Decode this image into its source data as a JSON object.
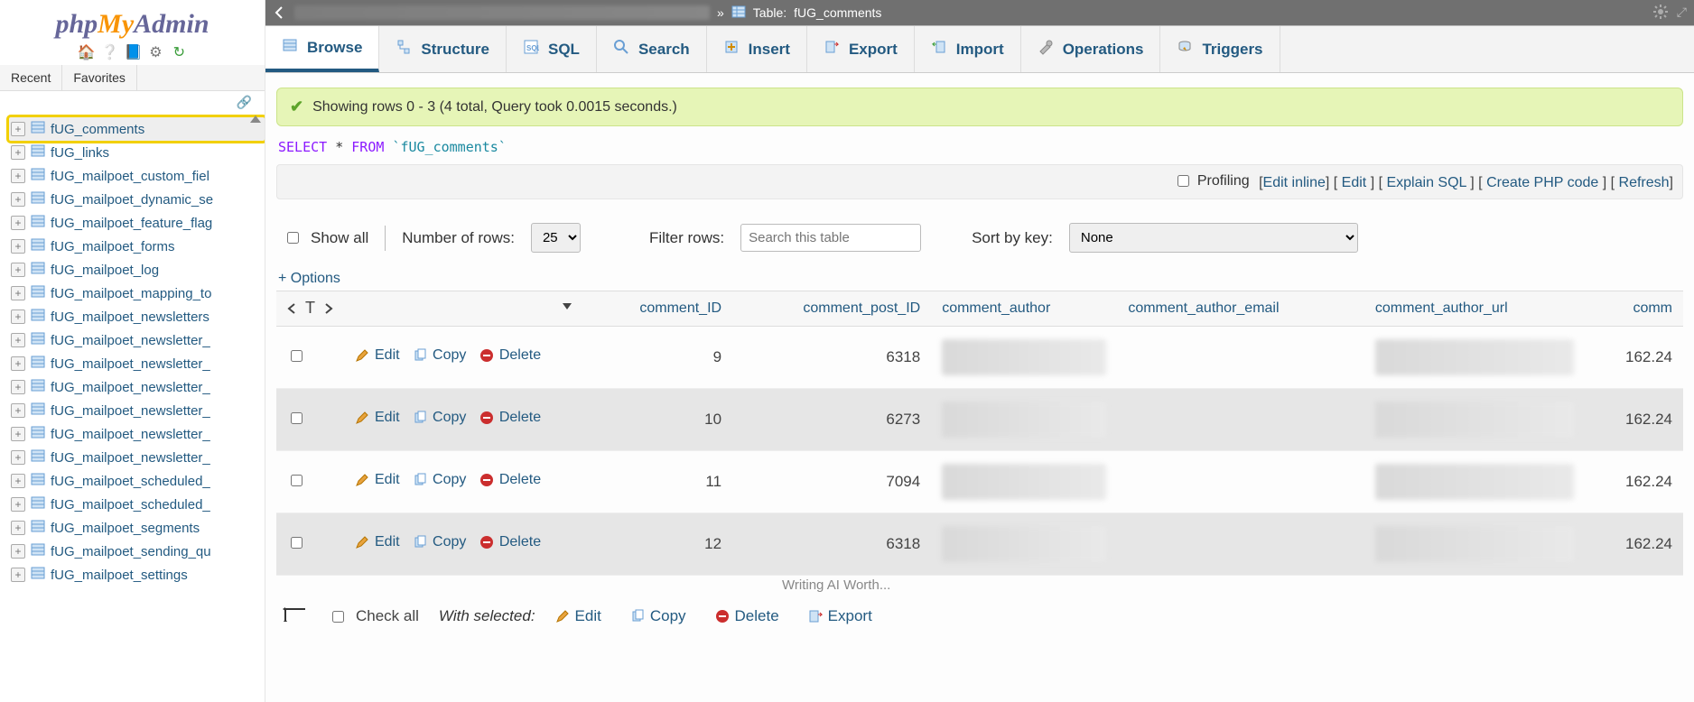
{
  "app_name": {
    "php": "php",
    "my": "My",
    "admin": "Admin"
  },
  "sidebar": {
    "tabs": {
      "recent": "Recent",
      "favorites": "Favorites"
    },
    "items": [
      {
        "name": "fUG_comments",
        "selected": true
      },
      {
        "name": "fUG_links"
      },
      {
        "name": "fUG_mailpoet_custom_fiel"
      },
      {
        "name": "fUG_mailpoet_dynamic_se"
      },
      {
        "name": "fUG_mailpoet_feature_flag"
      },
      {
        "name": "fUG_mailpoet_forms"
      },
      {
        "name": "fUG_mailpoet_log"
      },
      {
        "name": "fUG_mailpoet_mapping_to"
      },
      {
        "name": "fUG_mailpoet_newsletters"
      },
      {
        "name": "fUG_mailpoet_newsletter_"
      },
      {
        "name": "fUG_mailpoet_newsletter_"
      },
      {
        "name": "fUG_mailpoet_newsletter_"
      },
      {
        "name": "fUG_mailpoet_newsletter_"
      },
      {
        "name": "fUG_mailpoet_newsletter_"
      },
      {
        "name": "fUG_mailpoet_newsletter_"
      },
      {
        "name": "fUG_mailpoet_scheduled_"
      },
      {
        "name": "fUG_mailpoet_scheduled_"
      },
      {
        "name": "fUG_mailpoet_segments"
      },
      {
        "name": "fUG_mailpoet_sending_qu"
      },
      {
        "name": "fUG_mailpoet_settings"
      }
    ]
  },
  "titlebar": {
    "crumb_sep": "»",
    "table_label": "Table:",
    "table_name": "fUG_comments"
  },
  "tabs": {
    "browse": "Browse",
    "structure": "Structure",
    "sql": "SQL",
    "search": "Search",
    "insert": "Insert",
    "export": "Export",
    "import": "Import",
    "operations": "Operations",
    "triggers": "Triggers"
  },
  "message": "Showing rows 0 - 3 (4 total, Query took 0.0015 seconds.)",
  "sql": {
    "select": "SELECT",
    "star": "*",
    "from": "FROM",
    "table": "`fUG_comments`"
  },
  "query_actions": {
    "profiling": "Profiling",
    "edit_inline": "Edit inline",
    "edit": "Edit",
    "explain": "Explain SQL",
    "create_php": "Create PHP code",
    "refresh": "Refresh"
  },
  "controls": {
    "show_all": "Show all",
    "num_rows_label": "Number of rows:",
    "num_rows_value": "25",
    "filter_label": "Filter rows:",
    "filter_placeholder": "Search this table",
    "sort_label": "Sort by key:",
    "sort_value": "None"
  },
  "options_link": "+ Options",
  "columns": {
    "comment_ID": "comment_ID",
    "comment_post_ID": "comment_post_ID",
    "comment_author": "comment_author",
    "comment_author_email": "comment_author_email",
    "comment_author_url": "comment_author_url",
    "comment_more": "comm"
  },
  "row_actions": {
    "edit": "Edit",
    "copy": "Copy",
    "delete": "Delete"
  },
  "rows": [
    {
      "id": "9",
      "post_id": "6318",
      "ip": "162.24"
    },
    {
      "id": "10",
      "post_id": "6273",
      "ip": "162.24"
    },
    {
      "id": "11",
      "post_id": "7094",
      "ip": "162.24"
    },
    {
      "id": "12",
      "post_id": "6318",
      "ip": "162.24"
    }
  ],
  "numbers_footer_text": "Writing AI Worth...",
  "bulk": {
    "check_all": "Check all",
    "with_selected": "With selected:",
    "edit": "Edit",
    "copy": "Copy",
    "delete": "Delete",
    "export": "Export"
  }
}
